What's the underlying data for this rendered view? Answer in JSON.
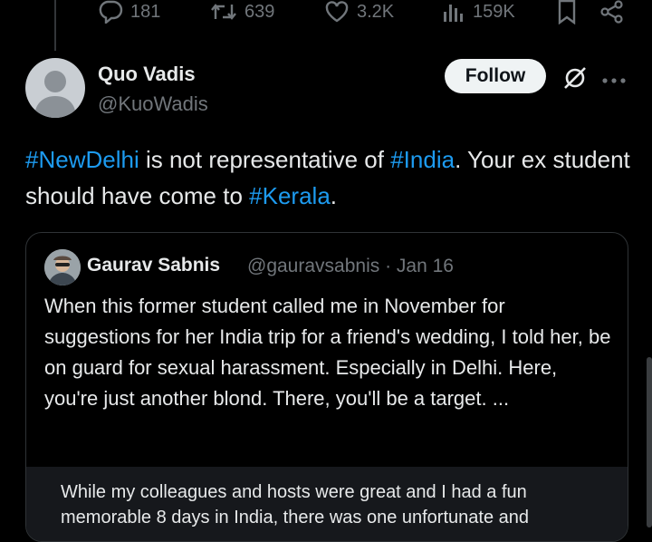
{
  "actions": {
    "replies": "181",
    "reposts": "639",
    "likes": "3.2K",
    "views": "159K"
  },
  "post": {
    "display_name": "Quo Vadis",
    "handle": "@KuoWadis",
    "follow_label": "Follow",
    "text_parts": [
      "#NewDelhi",
      " is not representative of ",
      "#India",
      ". Your ex student should have come to ",
      "#Kerala",
      "."
    ]
  },
  "quote": {
    "display_name": "Gaurav Sabnis",
    "handle_date": "@gauravsabnis · Jan 16",
    "text": "When this former student called me in November for suggestions for her India trip for a friend's wedding, I told her, be on guard for sexual harassment. Especially in Delhi. Here, you're just another blond. There, you'll be a target. ...",
    "media_text": "While my colleagues and hosts were great and I had a fun memorable 8 days in India, there was one unfortunate and"
  },
  "colors": {
    "background": "#000000",
    "text": "#e7e9ea",
    "muted": "#71767b",
    "link": "#1d9bf0",
    "border": "#2f3336"
  },
  "icons": [
    "reply-icon",
    "repost-icon",
    "like-icon",
    "views-icon",
    "bookmark-icon",
    "share-icon",
    "grok-icon",
    "more-icon"
  ]
}
